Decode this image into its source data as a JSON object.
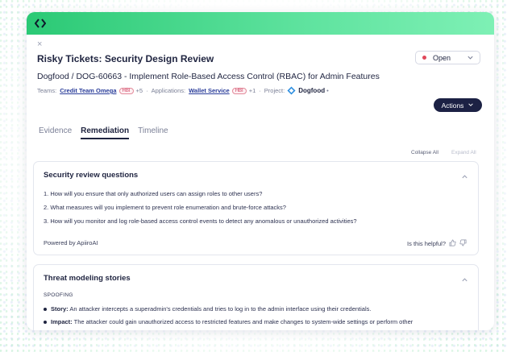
{
  "page": {
    "close_glyph": "×",
    "title": "Risky Tickets: Security Design Review",
    "status": {
      "label": "Open",
      "color": "#e0485a"
    },
    "subtitle": "Dogfood / DOG-60663 - Implement Role-Based Access Control (RBAC) for Admin Features",
    "meta": {
      "teams_label": "Teams:",
      "team_link": "Credit Team Omega",
      "team_badge": "HBI",
      "team_more": "+5",
      "sep1": "·",
      "apps_label": "Applications:",
      "app_link": "Wallet Service",
      "app_badge": "HBI",
      "app_more": "+1",
      "sep2": "·",
      "project_label": "Project:",
      "project_name": "Dogfood",
      "project_suffix": "•"
    },
    "actions_label": "Actions"
  },
  "tabs": [
    {
      "label": "Evidence"
    },
    {
      "label": "Remediation",
      "active": true
    },
    {
      "label": "Timeline"
    }
  ],
  "controls": {
    "collapse_all": "Collapse All",
    "expand_all": "Expand All"
  },
  "security_review": {
    "title": "Security review questions",
    "questions": [
      "1. How will you ensure that only authorized users can assign roles to other users?",
      "2. What measures will you implement to prevent role enumeration and brute-force attacks?",
      "3. How will you monitor and log role-based access control events to detect any anomalous or unauthorized activities?"
    ],
    "powered_by": "Powered by ApiiroAI",
    "helpful": "Is this helpful?"
  },
  "threat_modeling": {
    "title": "Threat modeling stories",
    "section": "SPOOFING",
    "stories": [
      {
        "label": "Story:",
        "text": " An attacker intercepts a superadmin's credentials and tries to log in to the admin interface using their credentials."
      },
      {
        "label": "Impact:",
        "text": " The attacker could gain unauthorized access to restricted features and make changes to system-wide settings or perform other"
      }
    ]
  },
  "colors": {
    "brand_green": "#2bc975",
    "navy": "#1c2144",
    "link": "#2a3d9a",
    "hbi": "#d04060"
  },
  "icons": [
    "code-brackets-icon",
    "close-icon",
    "chevron-down-icon",
    "chevron-up-icon",
    "diamond-project-icon",
    "thumbs-up-icon",
    "thumbs-down-icon"
  ]
}
